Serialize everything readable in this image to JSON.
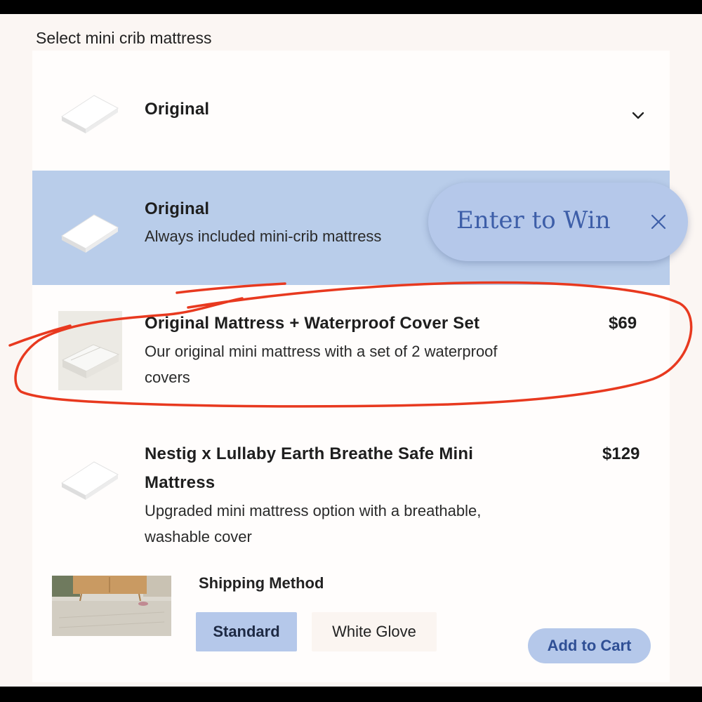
{
  "section_title": "Select mini crib mattress",
  "dropdown": {
    "selected_label": "Original",
    "icon": "chevron-down-icon"
  },
  "options": [
    {
      "name": "Original",
      "description": "Always included mini-crib mattress",
      "price": "",
      "selected": true
    },
    {
      "name": "Original Mattress + Waterproof Cover Set",
      "description_line1": "Our original mini mattress with a set of 2 waterproof",
      "description_line2": "covers",
      "price": "$69",
      "selected": false
    },
    {
      "name_line1": "Nestig x Lullaby Earth Breathe Safe Mini",
      "name_line2": "Mattress",
      "description_line1": "Upgraded mini mattress option with a breathable,",
      "description_line2": "washable cover",
      "price": "$129",
      "selected": false
    }
  ],
  "promo": {
    "label": "Enter to Win",
    "close_icon": "close-icon"
  },
  "shipping": {
    "label": "Shipping Method",
    "options": [
      "Standard",
      "White Glove"
    ],
    "selected": "Standard"
  },
  "cart": {
    "label": "Add to Cart"
  },
  "colors": {
    "selected_row": "#b9cdea",
    "accent_blue": "#3d5ea8",
    "annotation_red": "#e8391f",
    "page_bg": "#fbf6f3"
  }
}
